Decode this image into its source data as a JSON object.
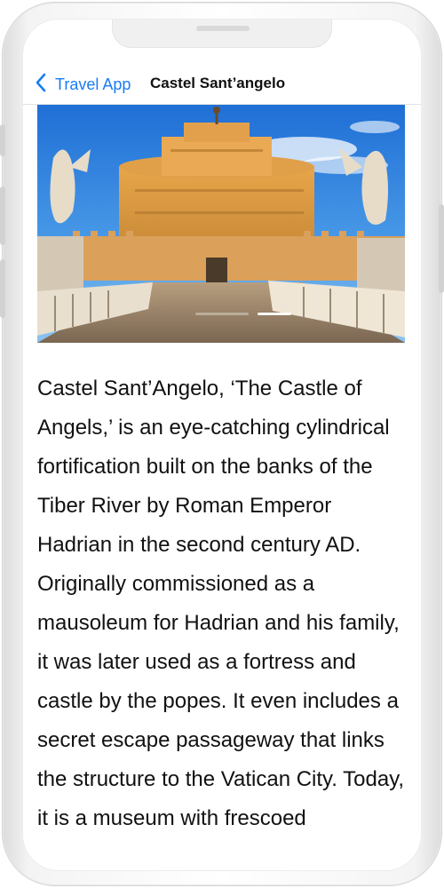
{
  "nav": {
    "back_label": "Travel App",
    "title": "Castel Sant’angelo"
  },
  "hero": {
    "image_alt": "Castel Sant'Angelo with angel statues on the bridge"
  },
  "article": {
    "text": "Castel Sant’Angelo, ‘The Castle of Angels,’ is an eye-catching cylindrical fortification built on the banks of the Tiber River by Roman Emperor Hadrian in the second century AD. Originally commissioned as a mausoleum for Hadrian and his family, it was later used as a fortress and castle by the popes. It even includes a secret escape passageway that links the structure to the Vatican City. Today, it is a museum with frescoed"
  },
  "colors": {
    "accent": "#1a7cf2",
    "text": "#111111"
  },
  "icons": {
    "back": "chevron-left-icon"
  }
}
